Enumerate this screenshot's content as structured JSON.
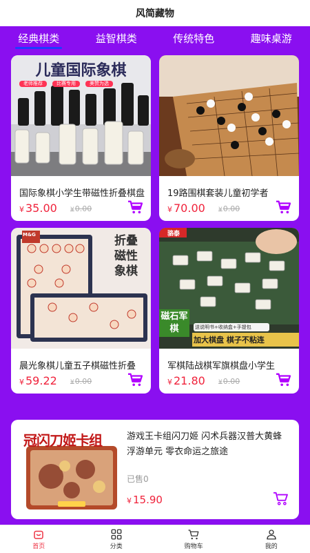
{
  "header": {
    "title": "风简藏物"
  },
  "tabs": [
    {
      "label": "经典棋类",
      "active": true
    },
    {
      "label": "益智棋类",
      "active": false
    },
    {
      "label": "传统特色",
      "active": false
    },
    {
      "label": "趣味桌游",
      "active": false
    }
  ],
  "products": [
    {
      "name": "国际象棋小学生带磁性折叠棋盘",
      "currency": "¥",
      "price": "35.00",
      "old_price": "0.00",
      "image_text": "儿童国际象棋",
      "image_tags": [
        "老师推荐",
        "比赛专用",
        "美赞为选"
      ]
    },
    {
      "name": "19路围棋套装儿童初学者",
      "currency": "¥",
      "price": "70.00",
      "old_price": "0.00"
    },
    {
      "name": "晨光象棋儿童五子棋磁性折叠",
      "currency": "¥",
      "price": "59.22",
      "old_price": "0.00",
      "image_brand": "M&G",
      "image_text": "折叠磁性象棋"
    },
    {
      "name": "军棋陆战棋军旗棋盘小学生",
      "currency": "¥",
      "price": "21.80",
      "old_price": "0.00",
      "image_brand": "骆泰",
      "image_badge": "磁石军棋",
      "image_promo": "送说明书+收纳盒+手提包",
      "image_slogan": "加大棋盘 棋子不粘连"
    }
  ],
  "featured": {
    "name": "游戏王卡组闪刀姬 闪术兵器汉普大黄蜂浮游单元 零衣命运之旅途",
    "sold": "已售0",
    "currency": "¥",
    "price": "15.90",
    "image_text": "冠闪刀姬卡组"
  },
  "bottom_nav": [
    {
      "label": "首页",
      "icon": "home-icon",
      "active": true
    },
    {
      "label": "分类",
      "icon": "grid-icon",
      "active": false
    },
    {
      "label": "购物车",
      "icon": "cart-icon",
      "active": false
    },
    {
      "label": "我的",
      "icon": "user-icon",
      "active": false
    }
  ],
  "colors": {
    "background": "#8a0ff0",
    "price": "#f0223b",
    "cart": "#b000ff",
    "tab_underline": "#1e3cff",
    "active_nav": "#ee3344"
  }
}
